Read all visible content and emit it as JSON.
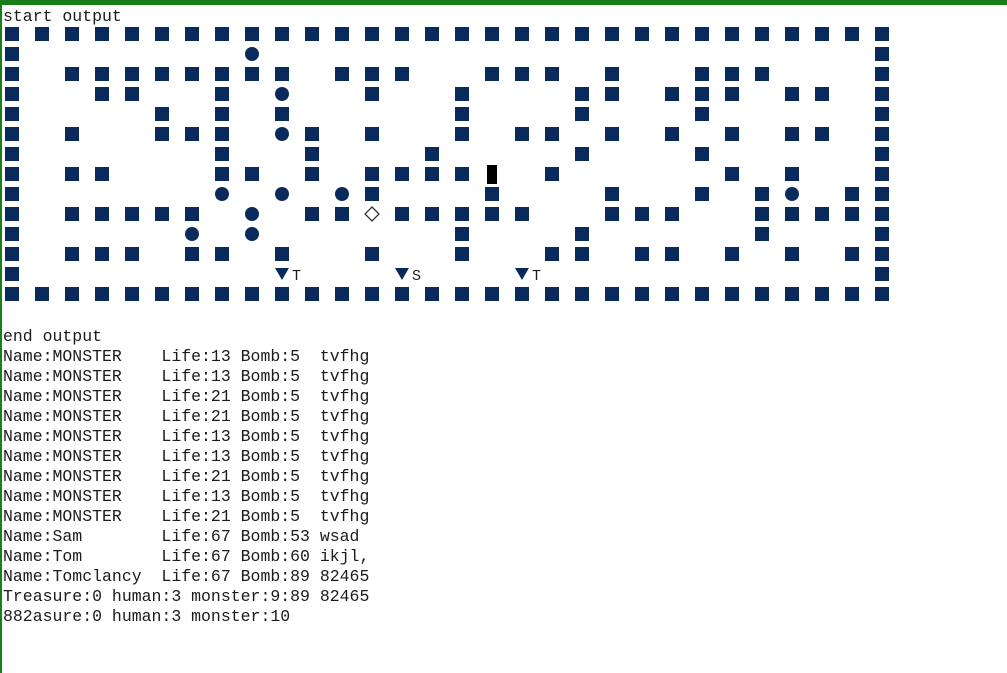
{
  "console": {
    "start_label": "start output",
    "end_label": "end output",
    "lines": [
      "Name:MONSTER    Life:13 Bomb:5  tvfhg",
      "Name:MONSTER    Life:13 Bomb:5  tvfhg",
      "Name:MONSTER    Life:21 Bomb:5  tvfhg",
      "Name:MONSTER    Life:21 Bomb:5  tvfhg",
      "Name:MONSTER    Life:13 Bomb:5  tvfhg",
      "Name:MONSTER    Life:13 Bomb:5  tvfhg",
      "Name:MONSTER    Life:21 Bomb:5  tvfhg",
      "Name:MONSTER    Life:13 Bomb:5  tvfhg",
      "Name:MONSTER    Life:21 Bomb:5  tvfhg",
      "Name:Sam        Life:67 Bomb:53 wsad",
      "Name:Tom        Life:67 Bomb:60 ikjl,",
      "Name:Tomclancy  Life:67 Bomb:89 82465",
      "Treasure:0 human:3 monster:9:89 82465",
      "882asure:0 human:3 monster:10"
    ]
  },
  "map": {
    "legend": {
      "#": "wall",
      "o": "monster",
      "d": "treasure",
      "C": "cursor",
      "A": "human T",
      "B": "human S"
    },
    "rows": [
      "##############################",
      "#       o                    #",
      "# ######## ###  ### #  ###   #",
      "#  ##  # o  #  #   ## ### ## #",
      "#    # # #     #   #   #     #",
      "# #  ### o# #  # ## # # # ## #",
      "#      #  #   #    #   #     #",
      "# ##   ## # ####C #     # #  #",
      "#      o o o#   #   #  # #o ##",
      "# ##### o ##d#####  ###  #####",
      "#     o o      #   #     #   #",
      "# ### ## #  #  #  ## ## # # ##",
      "#        A   B   A           #",
      "##############################"
    ],
    "human_labels": [
      "T",
      "S",
      "T"
    ],
    "wall_color": "#0b2a5c",
    "monster_color": "#0b2a5c",
    "cursor_color": "#000000",
    "treasure_color": "#333333"
  },
  "chrome": {
    "accent_color": "#1a7f1a"
  }
}
